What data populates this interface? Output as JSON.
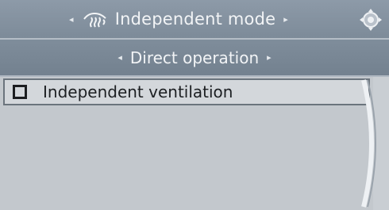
{
  "header": {
    "title": "Independent mode",
    "mode_icon": "seat-heating-icon",
    "controller_icon": "controller-icon"
  },
  "subheader": {
    "title": "Direct operation"
  },
  "list": {
    "items": [
      {
        "label": "Independent ventilation",
        "checked": false
      }
    ]
  },
  "colors": {
    "header_bg": "#8d9aa8",
    "list_bg": "#c3c8cd",
    "text_light": "#f2f4f6",
    "text_dark": "#1c1f22"
  }
}
